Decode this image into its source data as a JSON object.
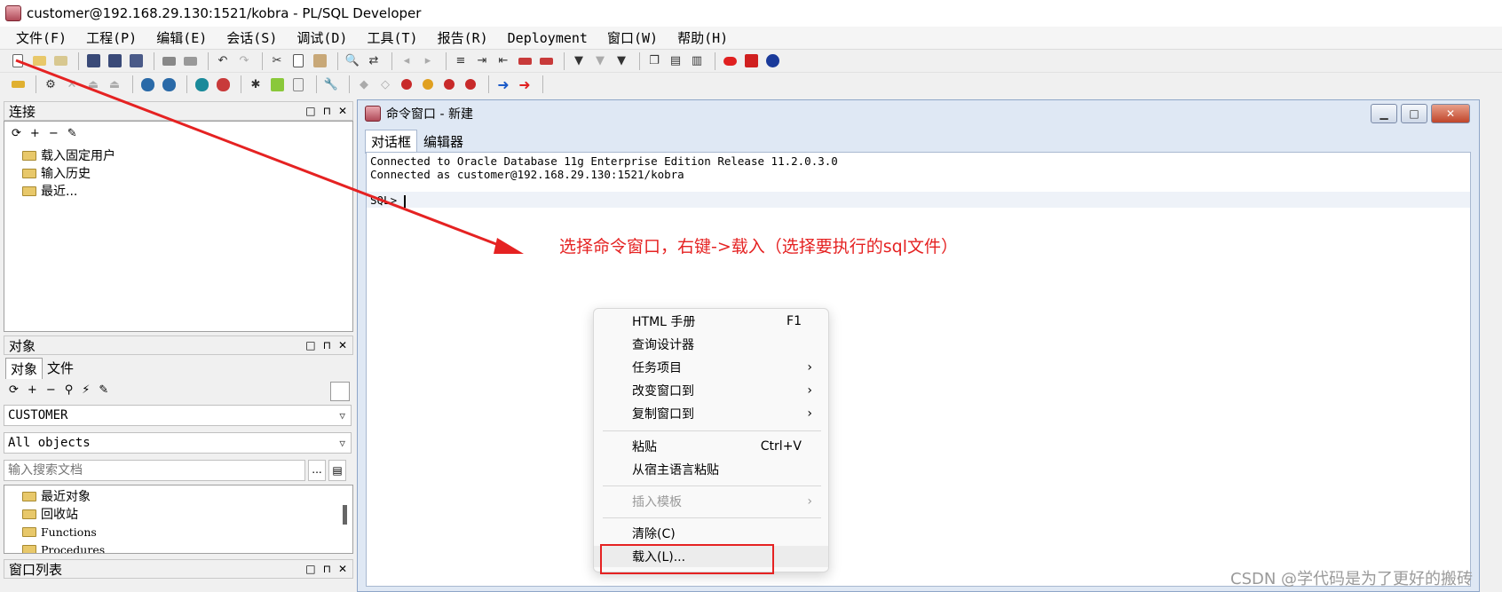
{
  "window": {
    "title": "customer@192.168.29.130:1521/kobra - PL/SQL Developer"
  },
  "menu": [
    "文件(F)",
    "工程(P)",
    "编辑(E)",
    "会话(S)",
    "调试(D)",
    "工具(T)",
    "报告(R)",
    "Deployment",
    "窗口(W)",
    "帮助(H)"
  ],
  "connect_panel": {
    "title": "连接",
    "items": [
      "载入固定用户",
      "输入历史",
      "最近..."
    ]
  },
  "object_panel": {
    "title": "对象",
    "tabs": [
      "对象",
      "文件"
    ],
    "schema": "CUSTOMER",
    "filter": "All objects",
    "search_placeholder": "输入搜索文档",
    "more_label": "...",
    "items": [
      "最近对象",
      "回收站",
      "Functions",
      "Procedures"
    ]
  },
  "window_list_panel": {
    "title": "窗口列表"
  },
  "panel_controls": [
    "□",
    "⊓",
    "✕"
  ],
  "command_window": {
    "title": "命令窗口 - 新建",
    "tabs": [
      "对话框",
      "编辑器"
    ],
    "lines": [
      "Connected to Oracle Database 11g Enterprise Edition Release 11.2.0.3.0",
      "Connected as customer@192.168.29.130:1521/kobra"
    ],
    "prompt": "SQL> "
  },
  "annotation": "选择命令窗口，右键->载入（选择要执行的sql文件）",
  "context_menu": {
    "items": [
      {
        "label": "HTML 手册",
        "shortcut": "F1"
      },
      {
        "label": "查询设计器"
      },
      {
        "label": "任务项目",
        "submenu": "›"
      },
      {
        "label": "改变窗口到",
        "submenu": "›"
      },
      {
        "label": "复制窗口到",
        "submenu": "›"
      },
      {
        "label": "粘贴",
        "shortcut": "Ctrl+V"
      },
      {
        "label": "从宿主语言粘贴"
      },
      {
        "label": "插入模板",
        "submenu": "›",
        "disabled": true
      },
      {
        "label": "清除(C)"
      },
      {
        "label": "载入(L)..."
      }
    ]
  },
  "watermark": "CSDN @学代码是为了更好的搬砖",
  "colors": {
    "annotation": "#e52222",
    "window_frame": "#dfe8f4"
  }
}
